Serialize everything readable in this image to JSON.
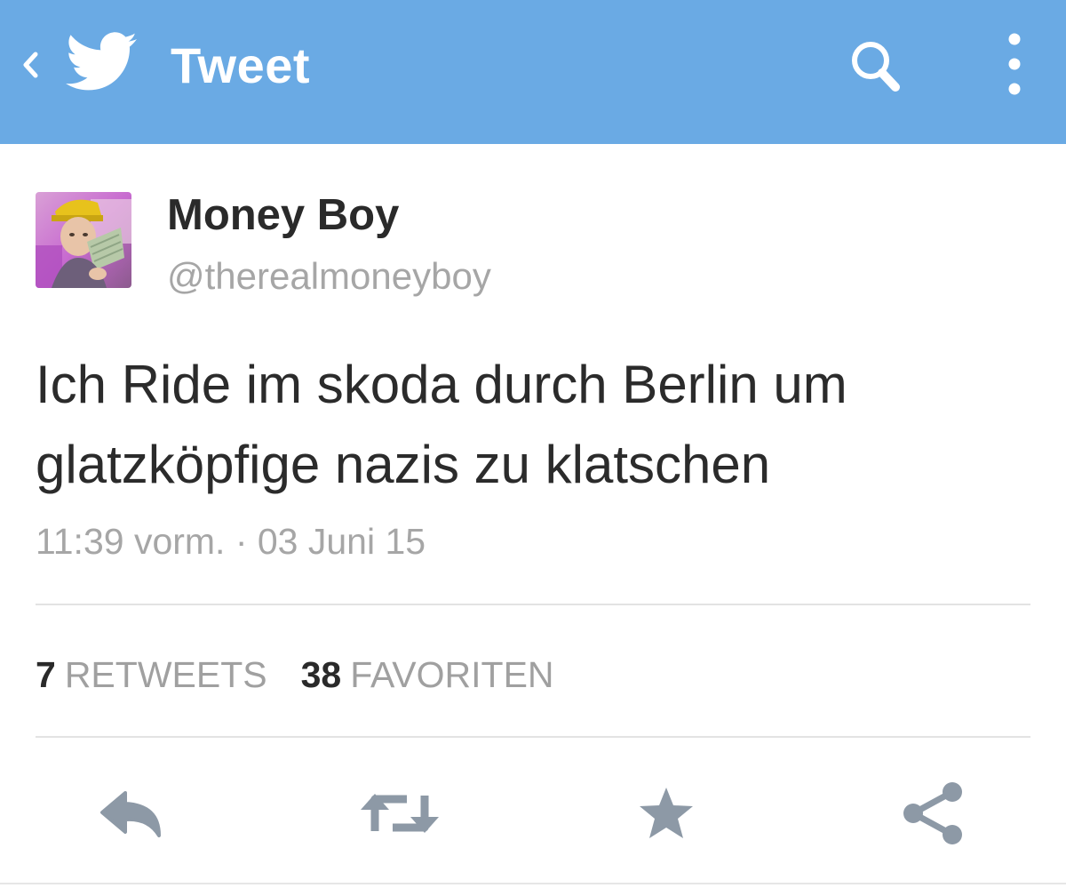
{
  "app_bar": {
    "title": "Tweet",
    "background_color": "#6aaae4",
    "icons": [
      "chevron-left-icon",
      "twitter-bird-icon",
      "search-icon",
      "more-vertical-icon"
    ]
  },
  "tweet": {
    "author": {
      "display_name": "Money Boy",
      "handle": "@therealmoneyboy"
    },
    "text_lines": [
      "Ich Ride im skoda durch Berlin um",
      "glatzköpfige nazis zu klatschen"
    ],
    "timestamp": "11:39 vorm. · 03 Juni 15",
    "stats": {
      "retweets_count": "7",
      "retweets_label": "RETWEETS",
      "favorites_count": "38",
      "favorites_label": "FAVORITEN"
    }
  },
  "actions": [
    "reply-icon",
    "retweet-icon",
    "favorite-star-icon",
    "share-icon"
  ]
}
